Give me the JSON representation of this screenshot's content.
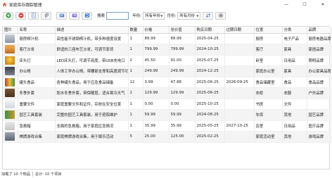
{
  "window": {
    "title": "家庭库存跟踪管理",
    "minimize": "—",
    "maximize": "☐",
    "close": "✕"
  },
  "toolbar": {
    "search_label": "搜索",
    "search_value": "",
    "year_label": "年份:",
    "year_value": "所有年份",
    "month_label": "月份:",
    "month_value": "所有月份"
  },
  "table": {
    "columns": [
      "图片",
      "名称",
      "描述",
      "数量",
      "价格",
      "总价值",
      "购买日期",
      "过期日期",
      "位置",
      "分类",
      "品牌"
    ],
    "rows": [
      {
        "name": "厨房榨汁机",
        "desc": "高性能不锈钢榨汁机，带多种速度设置",
        "qty": "1",
        "price": "89.99",
        "total": "89.99",
        "buy": "2025-04-25",
        "expire": "",
        "loc": "厨房",
        "cat": "电子产品",
        "brand": "厨房电器品牌"
      },
      {
        "name": "客厅沙发",
        "desc": "舒适的三座布艺沙发，可调节靠背",
        "qty": "1",
        "price": "799.99",
        "total": "799.99",
        "buy": "2024-10-25",
        "expire": "",
        "loc": "客厅",
        "cat": "家具",
        "brand": "家居品牌"
      },
      {
        "name": "床头灯",
        "desc": "LED床头灯，可调节亮度，带USB充电口",
        "qty": "2",
        "price": "45.50",
        "total": "91.00",
        "buy": "2025-07-25",
        "expire": "",
        "loc": "卧室",
        "cat": "日用品",
        "brand": "照明品牌"
      },
      {
        "name": "办公椅",
        "desc": "人体工学办公椅，带腰部支撑和高度调节功能",
        "qty": "1",
        "price": "249.99",
        "total": "249.99",
        "buy": "2024-12-25",
        "expire": "",
        "loc": "家庭办公室",
        "cat": "家具",
        "brand": "办公家具品牌"
      },
      {
        "name": "罐头食品",
        "desc": "各种罐头食品，用于应急食品储备",
        "qty": "12",
        "price": "3.99",
        "total": "47.88",
        "buy": "2025-06-25",
        "expire": "2026-09-25",
        "loc": "食品储藏室",
        "cat": "食品",
        "brand": "食品品牌"
      },
      {
        "name": "冬季外套",
        "desc": "防水冬季外套，带保暖层，适合寒冷天气",
        "qty": "1",
        "price": "129.99",
        "total": "129.99",
        "buy": "2025-06-25",
        "expire": "",
        "loc": "衣柜",
        "cat": "衣服",
        "brand": "户外品牌"
      },
      {
        "name": "重要文件",
        "desc": "家庭重要文件和证件，存放在安全位置",
        "qty": "1",
        "price": "0.00",
        "total": "0.00",
        "buy": "2025-10-25",
        "expire": "",
        "loc": "书房",
        "cat": "文件",
        "brand": ""
      },
      {
        "name": "园艺工具套装",
        "desc": "完整的园艺工具套装，用于庭院维护",
        "qty": "1",
        "price": "59.99",
        "total": "59.99",
        "buy": "2024-08-25",
        "expire": "",
        "loc": "车库",
        "cat": "其他",
        "brand": "园艺品牌"
      },
      {
        "name": "急救箱",
        "desc": "全面的急救箱，用于家庭应急情况",
        "qty": "1",
        "price": "35.99",
        "total": "35.99",
        "buy": "2025-05-25",
        "expire": "2027-10-25",
        "loc": "浴室",
        "cat": "日用品",
        "brand": "医疗品牌"
      },
      {
        "name": "棋牌游戏合集",
        "desc": "家庭棋牌游戏合集，用于娱乐活动",
        "qty": "5",
        "price": "25.00",
        "total": "125.00",
        "buy": "2025-02-25",
        "expire": "",
        "loc": "家庭活动室",
        "cat": "其他",
        "brand": "游戏品牌"
      }
    ]
  },
  "status": {
    "loaded": "加载了 10 个物品",
    "total": "总计: 10 个项目"
  },
  "colors": {
    "add": "#2e9e3e",
    "delete": "#d83a3a",
    "accent": "#2d6cc0"
  }
}
